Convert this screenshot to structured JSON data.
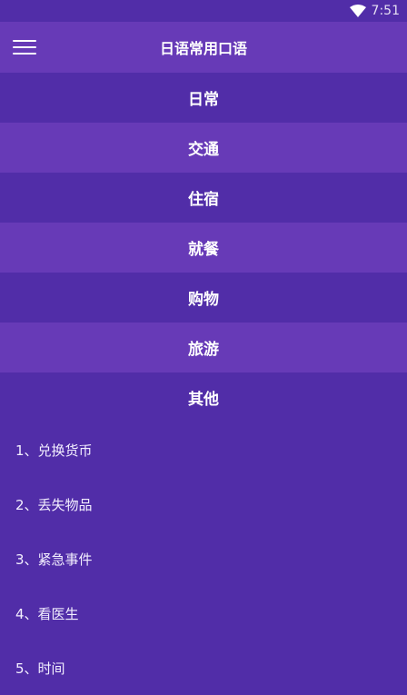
{
  "status": {
    "time": "7:51"
  },
  "header": {
    "title": "日语常用口语"
  },
  "categories": [
    {
      "label": "日常"
    },
    {
      "label": "交通"
    },
    {
      "label": "住宿"
    },
    {
      "label": "就餐"
    },
    {
      "label": "购物"
    },
    {
      "label": "旅游"
    },
    {
      "label": "其他"
    }
  ],
  "sub_items": [
    {
      "label": "1、兑换货币"
    },
    {
      "label": "2、丢失物品"
    },
    {
      "label": "3、紧急事件"
    },
    {
      "label": "4、看医生"
    },
    {
      "label": "5、时间"
    }
  ],
  "colors": {
    "primary": "#673ab7",
    "primary_dark": "#512da8"
  }
}
